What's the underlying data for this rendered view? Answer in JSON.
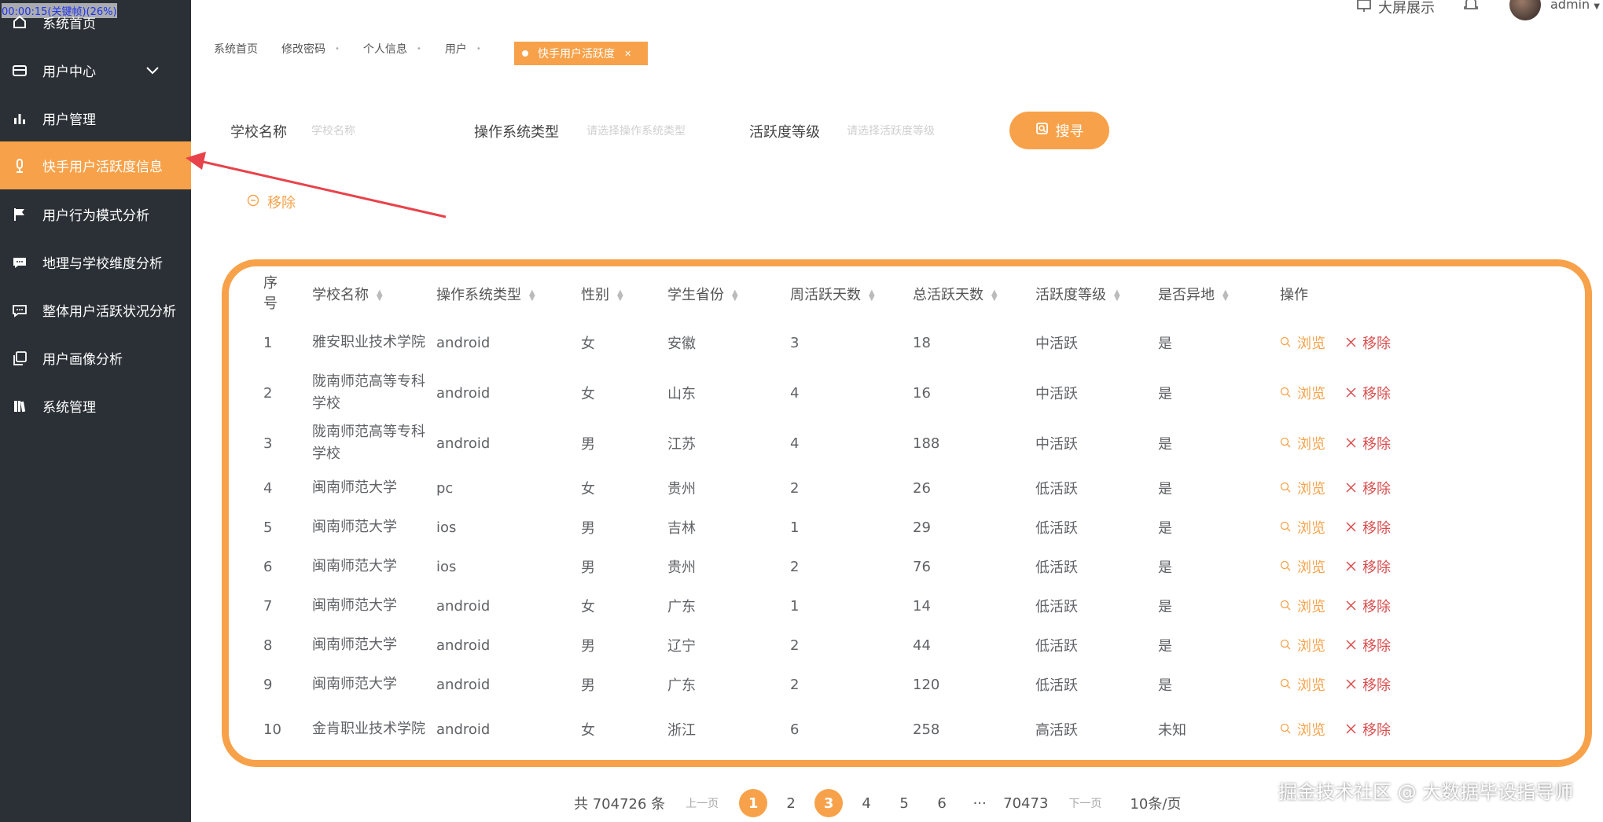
{
  "overlay": {
    "timer": "00:00:15(关键帧)(26%)"
  },
  "topbar": {
    "big_screen": "大屏展示",
    "user": "admin"
  },
  "sidebar": {
    "items": [
      {
        "label": "系统首页",
        "icon": "home-icon"
      },
      {
        "label": "用户中心",
        "icon": "card-icon"
      },
      {
        "label": "用户管理",
        "icon": "bar-chart-icon"
      },
      {
        "label": "快手用户活跃度信息",
        "icon": "bulb-icon"
      },
      {
        "label": "用户行为模式分析",
        "icon": "flag-icon"
      },
      {
        "label": "地理与学校维度分析",
        "icon": "chat-icon"
      },
      {
        "label": "整体用户活跃状况分析",
        "icon": "message-icon"
      },
      {
        "label": "用户画像分析",
        "icon": "copy-icon"
      },
      {
        "label": "系统管理",
        "icon": "book-icon"
      }
    ]
  },
  "breadcrumbs": [
    "系统首页",
    "修改密码",
    "个人信息",
    "用户"
  ],
  "active_tab": "快手用户活跃度",
  "search": {
    "school_label": "学校名称",
    "school_placeholder": "学校名称",
    "os_label": "操作系统类型",
    "os_placeholder": "请选择操作系统类型",
    "level_label": "活跃度等级",
    "level_placeholder": "请选择活跃度等级",
    "button": "搜寻"
  },
  "remove_label": "移除",
  "table": {
    "headers": [
      "序号",
      "学校名称",
      "操作系统类型",
      "性别",
      "学生省份",
      "周活跃天数",
      "总活跃天数",
      "活跃度等级",
      "是否异地",
      "操作"
    ],
    "view_label": "浏览",
    "delete_label": "移除",
    "rows": [
      [
        "1",
        "雅安职业技术学院",
        "android",
        "女",
        "安徽",
        "3",
        "18",
        "中活跃",
        "是"
      ],
      [
        "2",
        "陇南师范高等专科学校",
        "android",
        "女",
        "山东",
        "4",
        "16",
        "中活跃",
        "是"
      ],
      [
        "3",
        "陇南师范高等专科学校",
        "android",
        "男",
        "江苏",
        "4",
        "188",
        "中活跃",
        "是"
      ],
      [
        "4",
        "闽南师范大学",
        "pc",
        "女",
        "贵州",
        "2",
        "26",
        "低活跃",
        "是"
      ],
      [
        "5",
        "闽南师范大学",
        "ios",
        "男",
        "吉林",
        "1",
        "29",
        "低活跃",
        "是"
      ],
      [
        "6",
        "闽南师范大学",
        "ios",
        "男",
        "贵州",
        "2",
        "76",
        "低活跃",
        "是"
      ],
      [
        "7",
        "闽南师范大学",
        "android",
        "女",
        "广东",
        "1",
        "14",
        "低活跃",
        "是"
      ],
      [
        "8",
        "闽南师范大学",
        "android",
        "男",
        "辽宁",
        "2",
        "44",
        "低活跃",
        "是"
      ],
      [
        "9",
        "闽南师范大学",
        "android",
        "男",
        "广东",
        "2",
        "120",
        "低活跃",
        "是"
      ],
      [
        "10",
        "金肯职业技术学院",
        "android",
        "女",
        "浙江",
        "6",
        "258",
        "高活跃",
        "未知"
      ]
    ]
  },
  "pagination": {
    "total": "共 704726 条",
    "prev": "上一页",
    "pages": [
      "1",
      "2",
      "3",
      "4",
      "5",
      "6",
      "···",
      "70473"
    ],
    "current": "3",
    "next": "下一页",
    "page_size": "10条/页"
  },
  "watermark": "掘金技术社区 @ 大数据毕设指导师",
  "colors": {
    "accent": "#f7a24a",
    "sidebar": "#2b3036",
    "danger": "#d94e4e"
  }
}
